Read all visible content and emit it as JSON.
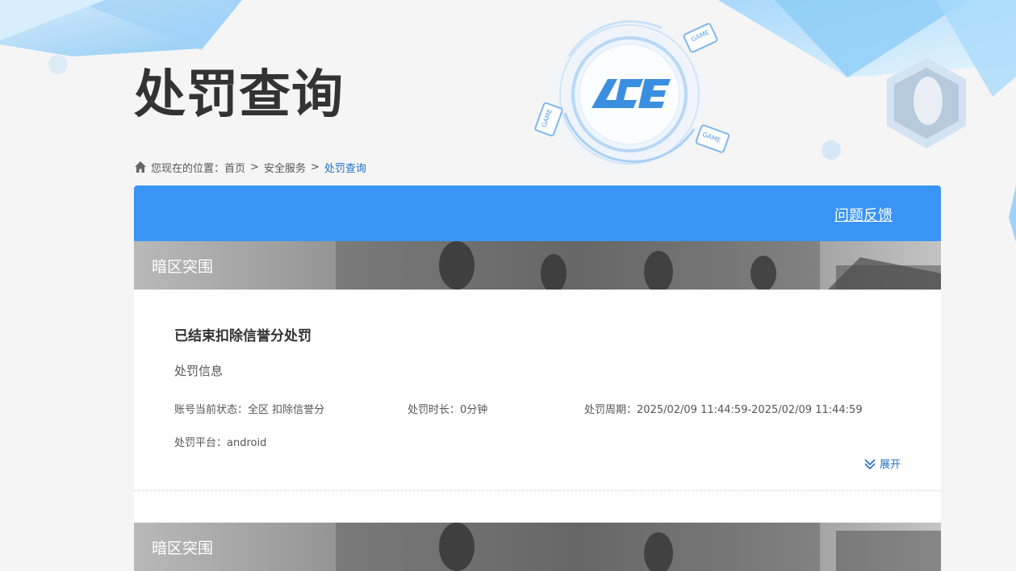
{
  "page": {
    "title": "处罚查询"
  },
  "breadcrumb": {
    "prefix": "您现在的位置：",
    "items": [
      "首页",
      "安全服务"
    ],
    "separator": ">",
    "current": "处罚查询"
  },
  "header": {
    "feedback_label": "问题反馈",
    "accent_color": "#3a94f5"
  },
  "records": [
    {
      "game": "暗区突围",
      "title": "已结束扣除信誉分处罚",
      "section": "处罚信息",
      "status_label": "账号当前状态：",
      "status_value": "全区 扣除信誉分",
      "duration_label": "处罚时长：",
      "duration_value": "0分钟",
      "period_label": "处罚周期：",
      "period_value": "2025/02/09 11:44:59-2025/02/09 11:44:59",
      "platform_label": "处罚平台：",
      "platform_value": "android",
      "expand_label": "展开"
    },
    {
      "game": "暗区突围"
    }
  ],
  "logo": {
    "text": "ACE",
    "badge_text": "GAME"
  }
}
